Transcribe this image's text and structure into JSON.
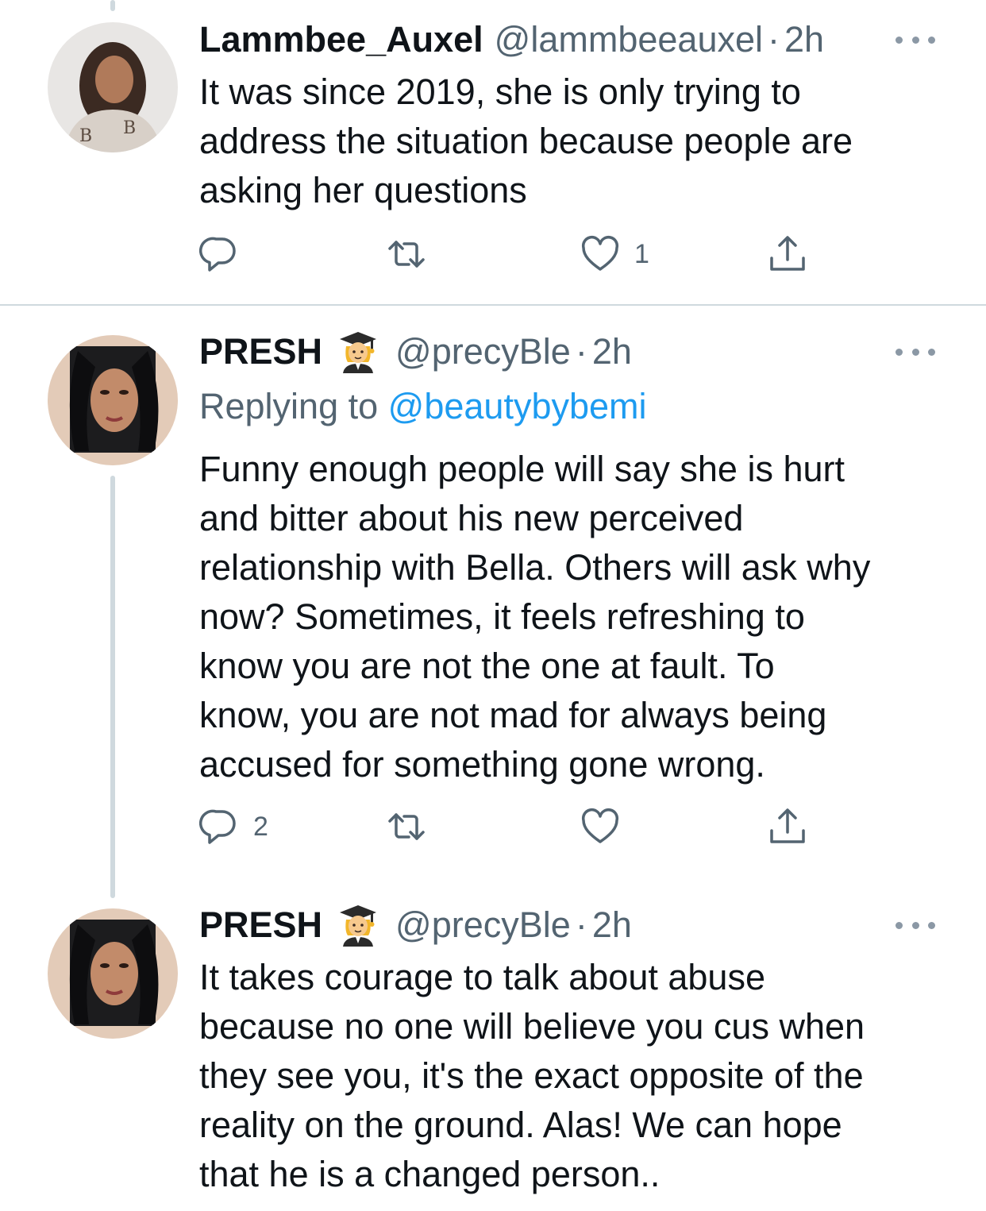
{
  "tweets": [
    {
      "display_name": "Lammbee_Auxel",
      "handle": "@lammbeeauxel",
      "time": "2h",
      "body_lines": [
        "It was since 2019, she is only trying to",
        "address the situation because people are",
        "asking her questions"
      ],
      "actions": {
        "reply_count": "",
        "retweet_count": "",
        "like_count": "1"
      }
    },
    {
      "display_name": "PRESH",
      "handle": "@precyBle",
      "time": "2h",
      "replying_label": "Replying to",
      "replying_to": "@beautybybemi",
      "body_lines": [
        "Funny enough people will say she is hurt",
        "and bitter about his new perceived",
        "relationship with Bella. Others will ask why",
        "now? Sometimes, it feels refreshing to",
        "know you are not the one at fault. To",
        "know, you are not mad for always being",
        "accused for something gone wrong."
      ],
      "actions": {
        "reply_count": "2",
        "retweet_count": "",
        "like_count": ""
      }
    },
    {
      "display_name": "PRESH",
      "handle": "@precyBle",
      "time": "2h",
      "body_lines": [
        "It takes courage to talk about abuse",
        "because no one will believe you cus when",
        "they see you, it's the exact opposite of the",
        "reality on the ground. Alas! We can hope",
        "that he is a changed person.."
      ]
    }
  ],
  "separator": "·",
  "colors": {
    "text": "#0f1419",
    "secondary": "#536471",
    "link": "#1d9bf0",
    "divider": "#cfd9de"
  },
  "icons": [
    "reply-icon",
    "retweet-icon",
    "like-icon",
    "share-icon",
    "more-icon",
    "student-emoji-icon"
  ]
}
